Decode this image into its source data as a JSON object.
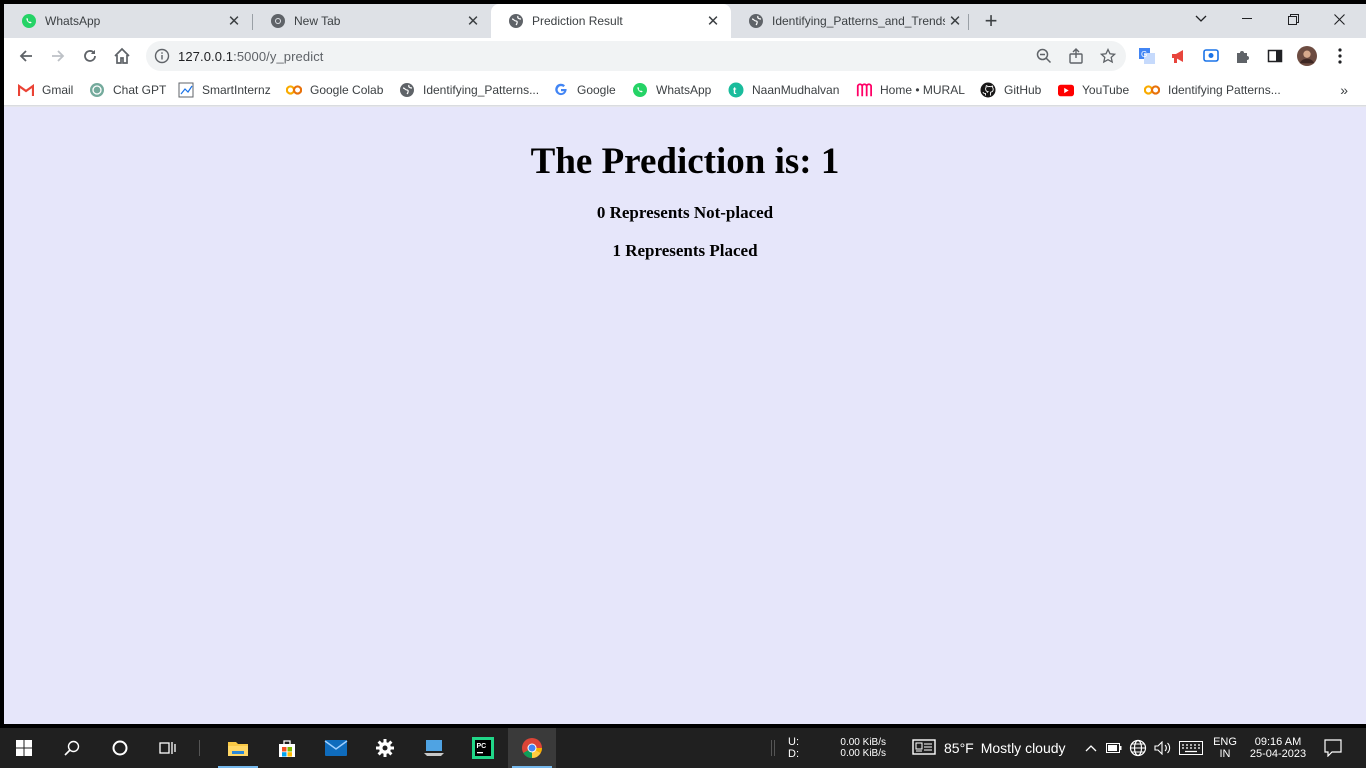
{
  "tabs": [
    {
      "title": "WhatsApp",
      "icon": "whatsapp-icon",
      "active": false
    },
    {
      "title": "New Tab",
      "icon": "chrome-icon",
      "active": false
    },
    {
      "title": "Prediction Result",
      "icon": "globe-icon",
      "active": true
    },
    {
      "title": "Identifying_Patterns_and_Trends_",
      "icon": "globe-icon",
      "active": false
    }
  ],
  "address": {
    "host": "127.0.0.1",
    "path": ":5000/y_predict"
  },
  "bookmarks": [
    {
      "label": "Gmail",
      "icon": "gmail-icon"
    },
    {
      "label": "Chat GPT",
      "icon": "chatgpt-icon"
    },
    {
      "label": "SmartInternz",
      "icon": "smartinternz-icon"
    },
    {
      "label": "Google Colab",
      "icon": "colab-icon"
    },
    {
      "label": "Identifying_Patterns...",
      "icon": "globe-icon"
    },
    {
      "label": "Google",
      "icon": "google-icon"
    },
    {
      "label": "WhatsApp",
      "icon": "whatsapp-icon"
    },
    {
      "label": "NaanMudhalvan",
      "icon": "naanmudhalvan-icon"
    },
    {
      "label": "Home • MURAL",
      "icon": "mural-icon"
    },
    {
      "label": "GitHub",
      "icon": "github-icon"
    },
    {
      "label": "YouTube",
      "icon": "youtube-icon"
    },
    {
      "label": "Identifying Patterns...",
      "icon": "colab-icon"
    }
  ],
  "bookmarks_more": "»",
  "page": {
    "heading": "The Prediction is: 1",
    "line1": "0 Represents Not-placed",
    "line2": "1 Represents Placed"
  },
  "taskbar": {
    "net_up_label": "U:",
    "net_down_label": "D:",
    "net_up": "0.00 KiB/s",
    "net_down": "0.00 KiB/s",
    "weather_temp": "85°F",
    "weather_desc": "Mostly cloudy",
    "lang": "ENG",
    "region": "IN",
    "time": "09:16 AM",
    "date": "25-04-2023"
  },
  "colors": {
    "page_bg": "#e6e6fa",
    "tabstrip_bg": "#dee1e6",
    "taskbar_bg": "#202020"
  }
}
